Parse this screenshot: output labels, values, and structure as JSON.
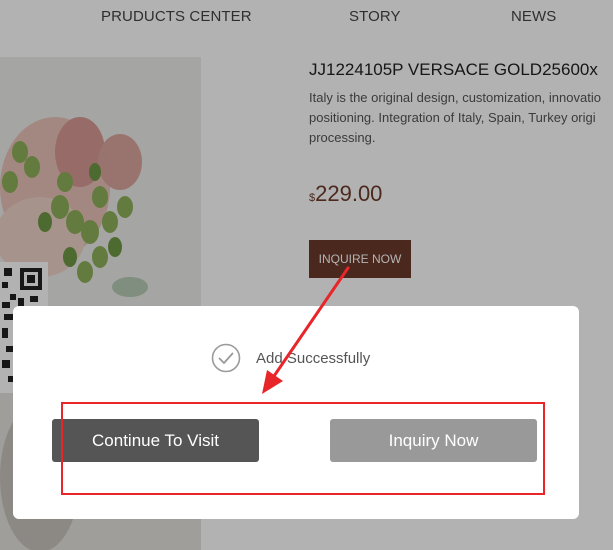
{
  "nav": {
    "products_center": "PRUDUCTS CENTER",
    "story": "STORY",
    "news": "NEWS"
  },
  "product": {
    "title": "JJ1224105P VERSACE GOLD25600x",
    "description": "Italy is the original design, customization, innovatio positioning. Integration of Italy, Spain, Turkey origi processing.",
    "currency_symbol": "$",
    "price": "229.00",
    "inquire_label": "INQUIRE NOW",
    "image_icon": "succulent-plant-photo",
    "qr_icon": "qr-code-icon"
  },
  "dialog": {
    "message": "Add Successfully",
    "check_icon": "check-circle-icon",
    "continue_label": "Continue To Visit",
    "inquiry_label": "Inquiry Now"
  },
  "colors": {
    "accent_brown": "#6b3a2b",
    "price_brown": "#6e3b2b",
    "dark_button": "#555555",
    "light_button": "#999999",
    "annotation_red": "#e8262a"
  }
}
